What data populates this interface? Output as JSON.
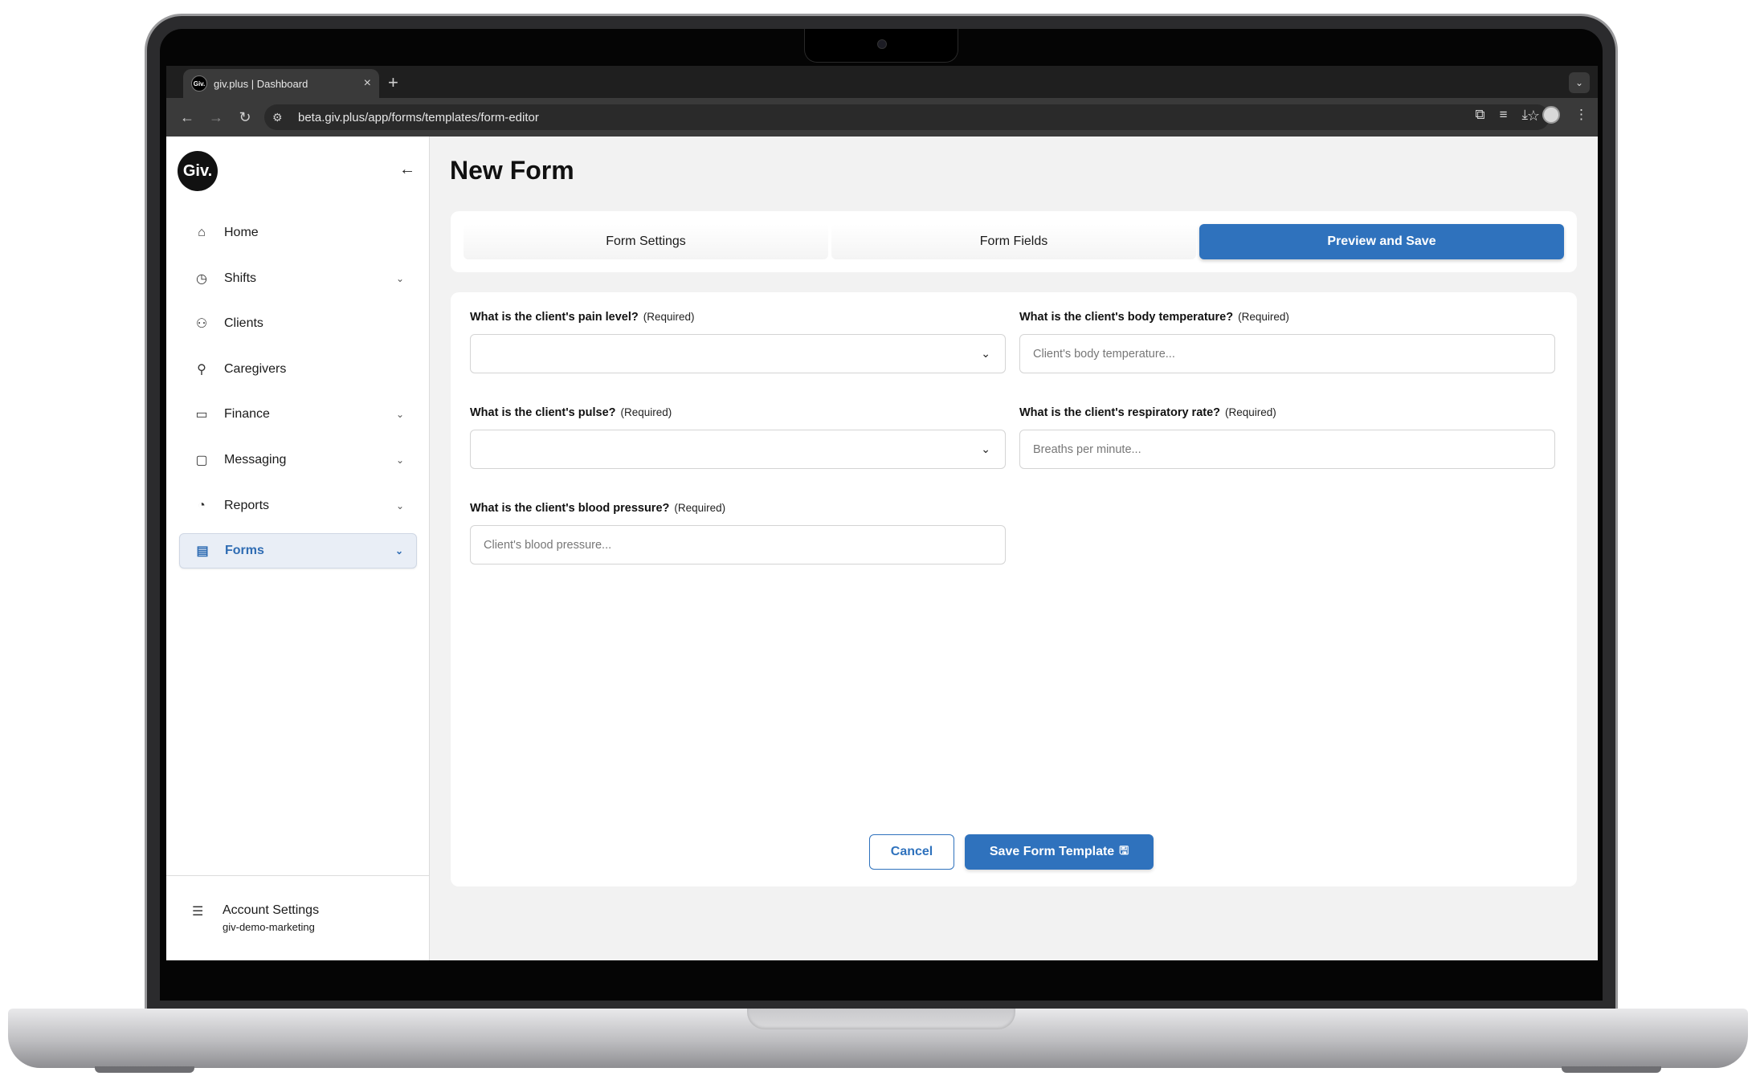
{
  "browser": {
    "tab_title": "giv.plus | Dashboard",
    "tab_favicon_text": "Giv.",
    "url": "beta.giv.plus/app/forms/templates/form-editor"
  },
  "sidebar": {
    "logo_text": "Giv.",
    "items": [
      {
        "label": "Home",
        "icon": "home-icon",
        "has_chevron": false
      },
      {
        "label": "Shifts",
        "icon": "stopwatch-icon",
        "has_chevron": true
      },
      {
        "label": "Clients",
        "icon": "users-icon",
        "has_chevron": false
      },
      {
        "label": "Caregivers",
        "icon": "user-icon",
        "has_chevron": false
      },
      {
        "label": "Finance",
        "icon": "card-icon",
        "has_chevron": true
      },
      {
        "label": "Messaging",
        "icon": "chat-icon",
        "has_chevron": true
      },
      {
        "label": "Reports",
        "icon": "pie-chart-icon",
        "has_chevron": true
      },
      {
        "label": "Forms",
        "icon": "document-icon",
        "has_chevron": true,
        "active": true
      }
    ],
    "account": {
      "label": "Account Settings",
      "org": "giv-demo-marketing"
    }
  },
  "page": {
    "title": "New Form",
    "steps": [
      "Form Settings",
      "Form Fields",
      "Preview and Save"
    ],
    "active_step": "Preview and Save"
  },
  "form": {
    "required_tag": "(Required)",
    "fields": [
      {
        "label": "What is the client's pain level?",
        "type": "select",
        "value": "",
        "placeholder": ""
      },
      {
        "label": "What is the client's body temperature?",
        "type": "text",
        "value": "",
        "placeholder": "Client's body temperature..."
      },
      {
        "label": "What is the client's pulse?",
        "type": "select",
        "value": "",
        "placeholder": ""
      },
      {
        "label": "What is the client's respiratory rate?",
        "type": "text",
        "value": "",
        "placeholder": "Breaths per minute..."
      },
      {
        "label": "What is the client's blood pressure?",
        "type": "text",
        "value": "",
        "placeholder": "Client's blood pressure..."
      }
    ],
    "cancel_label": "Cancel",
    "save_label": "Save Form Template"
  },
  "colors": {
    "accent": "#2f72bd",
    "active_nav_bg": "#e9eef6",
    "page_bg": "#f2f2f2"
  }
}
